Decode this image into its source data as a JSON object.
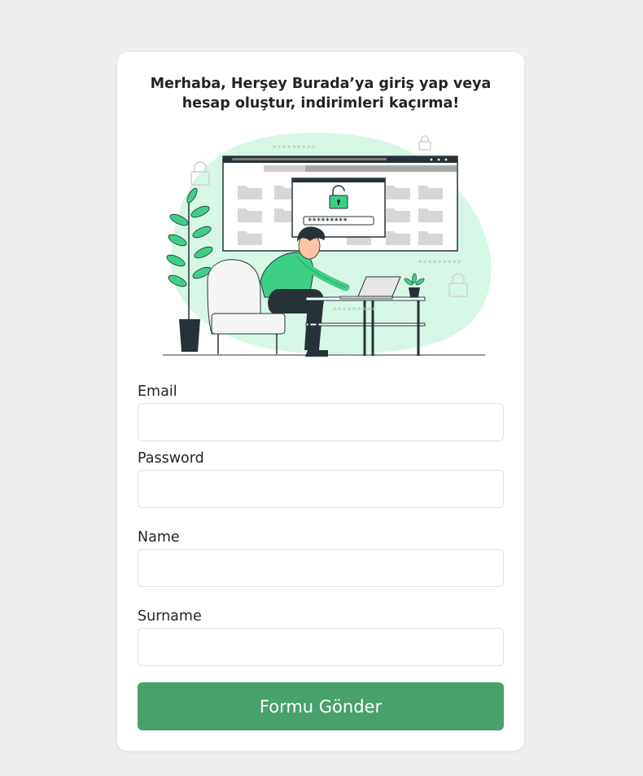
{
  "header": {
    "title": "Merhaba, Herşey Burada’ya giriş yap veya hesap oluştur, indirimleri kaçırma!"
  },
  "illustration": {
    "password_mask": "*********",
    "icon": "password-security-illustration"
  },
  "form": {
    "fields": [
      {
        "label": "Email",
        "value": "",
        "placeholder": ""
      },
      {
        "label": "Password",
        "value": "",
        "placeholder": ""
      },
      {
        "label": "Name",
        "value": "",
        "placeholder": ""
      },
      {
        "label": "Surname",
        "value": "",
        "placeholder": ""
      }
    ],
    "submit_label": "Formu Gönder"
  },
  "colors": {
    "page_background": "#efefef",
    "card_background": "#ffffff",
    "accent_green": "#48a06a",
    "illustration_green": "#3ecf86",
    "illustration_blob": "#d6f7e5"
  }
}
